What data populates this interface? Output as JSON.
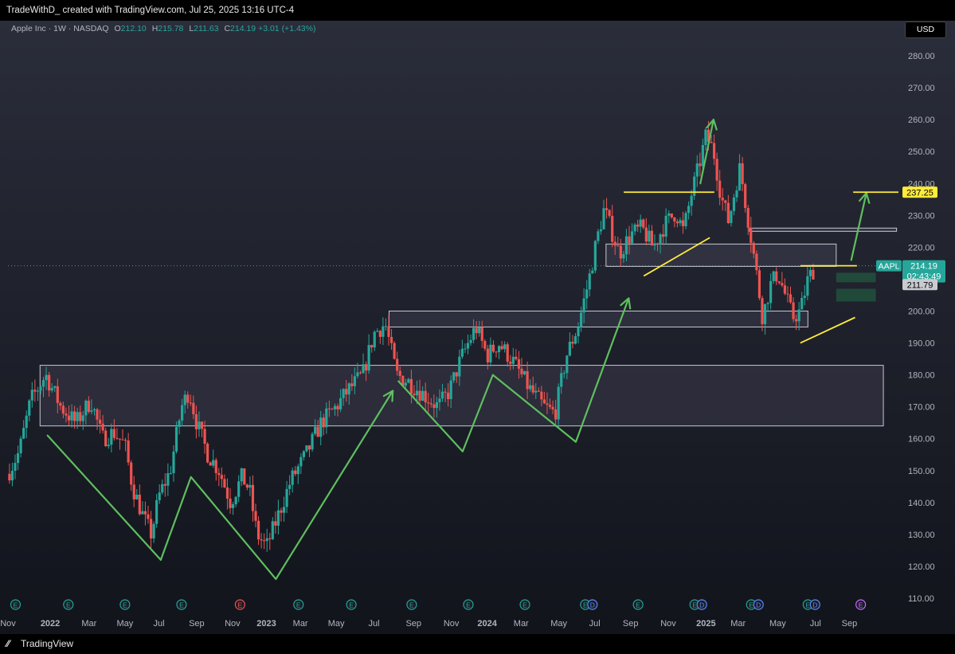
{
  "header": {
    "text": "TradeWithD_ created with TradingView.com, Jul 25, 2025 13:16 UTC-4"
  },
  "legend": {
    "symbol": "Apple Inc · 1W · NASDAQ",
    "o_label": "O",
    "o": "212.10",
    "h_label": "H",
    "h": "215.78",
    "l_label": "L",
    "l": "211.63",
    "c_label": "C",
    "c": "214.19",
    "change": "+3.01 (+1.43%)"
  },
  "currency_button": "USD",
  "footer": {
    "brand": "TradingView",
    "logo": "tv-logo-icon"
  },
  "colors": {
    "background_top": "#2a2d3a",
    "background_bottom": "#12141c",
    "up": "#26a69a",
    "down": "#ef5350",
    "arrow": "#5fbf5f",
    "trendline": "#ffeb3b",
    "zone_stroke": "#c8c8d0"
  },
  "chart_data": {
    "type": "candlestick",
    "symbol": "AAPL",
    "timeframe": "1W",
    "ylim": [
      105,
      290
    ],
    "y_ticks": [
      110,
      120,
      130,
      140,
      150,
      160,
      170,
      180,
      190,
      200,
      210,
      220,
      230,
      240,
      250,
      260,
      270,
      280
    ],
    "x_ticks": [
      {
        "label": "Nov",
        "t": 0
      },
      {
        "label": "2022",
        "t": 0.112
      },
      {
        "label": "Mar",
        "t": 0.215
      },
      {
        "label": "May",
        "t": 0.31
      },
      {
        "label": "Jul",
        "t": 0.4
      },
      {
        "label": "Sep",
        "t": 0.5
      },
      {
        "label": "Nov",
        "t": 0.595
      },
      {
        "label": "2023",
        "t": 0.685
      },
      {
        "label": "Mar",
        "t": 0.775
      },
      {
        "label": "May",
        "t": 0.87
      },
      {
        "label": "Jul",
        "t": 0.97
      },
      {
        "label": "Sep",
        "t": 1.075
      },
      {
        "label": "Nov",
        "t": 1.175
      },
      {
        "label": "2024",
        "t": 1.27
      },
      {
        "label": "Mar",
        "t": 1.36
      },
      {
        "label": "May",
        "t": 1.46
      },
      {
        "label": "Jul",
        "t": 1.555
      },
      {
        "label": "Sep",
        "t": 1.65
      },
      {
        "label": "Nov",
        "t": 1.75
      },
      {
        "label": "2025",
        "t": 1.85
      },
      {
        "label": "Mar",
        "t": 1.935
      },
      {
        "label": "May",
        "t": 2.04
      },
      {
        "label": "Jul",
        "t": 2.14
      },
      {
        "label": "Sep",
        "t": 2.23
      }
    ],
    "price_path": [
      [
        0,
        149
      ],
      [
        0.03,
        156
      ],
      [
        0.06,
        172
      ],
      [
        0.1,
        180
      ],
      [
        0.14,
        170
      ],
      [
        0.18,
        165
      ],
      [
        0.22,
        172
      ],
      [
        0.25,
        160
      ],
      [
        0.28,
        162
      ],
      [
        0.31,
        158
      ],
      [
        0.33,
        145
      ],
      [
        0.36,
        135
      ],
      [
        0.38,
        130
      ],
      [
        0.4,
        142
      ],
      [
        0.43,
        150
      ],
      [
        0.46,
        170
      ],
      [
        0.48,
        175
      ],
      [
        0.5,
        165
      ],
      [
        0.53,
        155
      ],
      [
        0.56,
        150
      ],
      [
        0.59,
        140
      ],
      [
        0.62,
        148
      ],
      [
        0.64,
        144
      ],
      [
        0.66,
        130
      ],
      [
        0.685,
        126
      ],
      [
        0.71,
        134
      ],
      [
        0.75,
        147
      ],
      [
        0.79,
        155
      ],
      [
        0.83,
        165
      ],
      [
        0.87,
        170
      ],
      [
        0.9,
        175
      ],
      [
        0.94,
        180
      ],
      [
        0.97,
        193
      ],
      [
        1.0,
        196
      ],
      [
        1.03,
        180
      ],
      [
        1.06,
        178
      ],
      [
        1.1,
        174
      ],
      [
        1.14,
        170
      ],
      [
        1.17,
        175
      ],
      [
        1.2,
        185
      ],
      [
        1.24,
        195
      ],
      [
        1.27,
        186
      ],
      [
        1.3,
        190
      ],
      [
        1.34,
        184
      ],
      [
        1.38,
        176
      ],
      [
        1.42,
        170
      ],
      [
        1.45,
        168
      ],
      [
        1.48,
        186
      ],
      [
        1.51,
        195
      ],
      [
        1.54,
        210
      ],
      [
        1.56,
        222
      ],
      [
        1.58,
        232
      ],
      [
        1.6,
        225
      ],
      [
        1.62,
        218
      ],
      [
        1.65,
        224
      ],
      [
        1.68,
        226
      ],
      [
        1.71,
        220
      ],
      [
        1.74,
        227
      ],
      [
        1.77,
        231
      ],
      [
        1.79,
        225
      ],
      [
        1.81,
        236
      ],
      [
        1.83,
        245
      ],
      [
        1.85,
        255
      ],
      [
        1.87,
        250
      ],
      [
        1.89,
        236
      ],
      [
        1.91,
        228
      ],
      [
        1.93,
        240
      ],
      [
        1.94,
        245
      ],
      [
        1.96,
        230
      ],
      [
        1.98,
        215
      ],
      [
        2.0,
        198
      ],
      [
        2.02,
        208
      ],
      [
        2.04,
        212
      ],
      [
        2.06,
        205
      ],
      [
        2.08,
        198
      ],
      [
        2.1,
        200
      ],
      [
        2.12,
        210
      ],
      [
        2.14,
        214
      ]
    ],
    "ohlc_last": {
      "open": 212.1,
      "high": 215.78,
      "low": 211.63,
      "close": 214.19,
      "change": 3.01,
      "change_pct": 1.43
    },
    "current_price": "214.19",
    "price_label": "AAPL",
    "countdown": "02:43:49",
    "secondary_price": "211.79",
    "target_price": "237.25",
    "zones": [
      {
        "t0": 0.085,
        "t1": 2.32,
        "y0": 164,
        "y1": 183
      },
      {
        "t0": 1.01,
        "t1": 2.12,
        "y0": 195,
        "y1": 200
      },
      {
        "t0": 1.585,
        "t1": 2.195,
        "y0": 214,
        "y1": 221
      },
      {
        "t0": 1.965,
        "t1": 2.355,
        "y0": 225,
        "y1": 226
      }
    ],
    "demand_zones": [
      {
        "t0": 2.195,
        "t1": 2.3,
        "y0": 209,
        "y1": 212
      },
      {
        "t0": 2.195,
        "t1": 2.3,
        "y0": 203,
        "y1": 207
      }
    ],
    "green_paths": [
      [
        [
          0.105,
          161
        ],
        [
          0.405,
          122
        ],
        [
          0.485,
          148
        ],
        [
          0.71,
          116
        ],
        [
          1.02,
          175
        ]
      ],
      [
        [
          1.035,
          178
        ],
        [
          1.205,
          156
        ],
        [
          1.285,
          180
        ],
        [
          1.505,
          159
        ],
        [
          1.645,
          204
        ]
      ],
      [
        [
          1.835,
          240
        ],
        [
          1.87,
          260
        ]
      ],
      [
        [
          2.235,
          216
        ],
        [
          2.275,
          237
        ]
      ]
    ],
    "yellow_lines": [
      {
        "t0": 1.632,
        "t1": 1.872,
        "y0": 237.25,
        "y1": 237.25
      },
      {
        "t0": 1.685,
        "t1": 1.86,
        "y0": 211,
        "y1": 223
      },
      {
        "t0": 2.1,
        "t1": 2.25,
        "y0": 214.19,
        "y1": 214.19
      },
      {
        "t0": 2.1,
        "t1": 2.245,
        "y0": 190,
        "y1": 198
      },
      {
        "t0": 2.24,
        "t1": 2.36,
        "y0": 237.25,
        "y1": 237.25
      }
    ],
    "earnings_markers": [
      0.02,
      0.16,
      0.31,
      0.46,
      0.615,
      0.77,
      0.91,
      1.07,
      1.22,
      1.37,
      1.53,
      1.67,
      1.82,
      1.97,
      2.12,
      2.26
    ],
    "earnings_label": "E",
    "dividend_label": "D"
  }
}
